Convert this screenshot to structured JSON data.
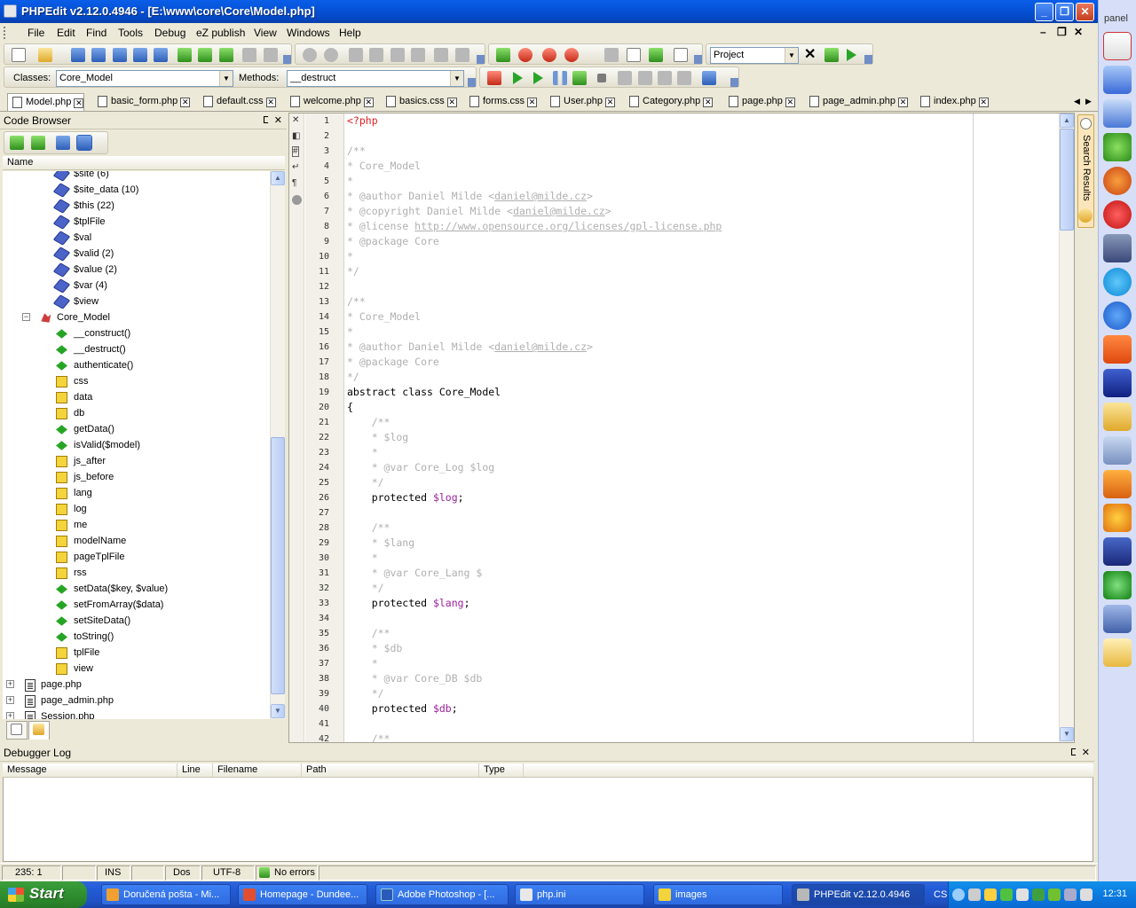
{
  "window": {
    "title": "PHPEdit v2.12.0.4946 - [E:\\www\\core\\Core\\Model.php]"
  },
  "menu": [
    "File",
    "Edit",
    "Find",
    "Tools",
    "Debug",
    "eZ publish",
    "View",
    "Windows",
    "Help"
  ],
  "toolbar": {
    "project_combo": "Project",
    "classes_label": "Classes:",
    "classes_value": "Core_Model",
    "methods_label": "Methods:",
    "methods_value": "__destruct"
  },
  "tabs": [
    "Model.php",
    "basic_form.php",
    "default.css",
    "welcome.php",
    "basics.css",
    "forms.css",
    "User.php",
    "Category.php",
    "page.php",
    "page_admin.php",
    "index.php"
  ],
  "code_browser": {
    "title": "Code Browser",
    "column_name": "Name",
    "items": [
      {
        "label": "$site  (6)",
        "icon": "var"
      },
      {
        "label": "$site_data   (10)",
        "icon": "var"
      },
      {
        "label": "$this   (22)",
        "icon": "var"
      },
      {
        "label": "$tplFile",
        "icon": "var"
      },
      {
        "label": "$val",
        "icon": "var"
      },
      {
        "label": "$valid   (2)",
        "icon": "var"
      },
      {
        "label": "$value   (2)",
        "icon": "var"
      },
      {
        "label": "$var   (4)",
        "icon": "var"
      },
      {
        "label": "$view",
        "icon": "var"
      },
      {
        "label": "Core_Model",
        "icon": "class"
      },
      {
        "label": "__construct()",
        "icon": "method"
      },
      {
        "label": "__destruct()",
        "icon": "method"
      },
      {
        "label": "authenticate()",
        "icon": "method"
      },
      {
        "label": "css",
        "icon": "property"
      },
      {
        "label": "data",
        "icon": "property"
      },
      {
        "label": "db",
        "icon": "property"
      },
      {
        "label": "getData()",
        "icon": "method"
      },
      {
        "label": "isValid($model)",
        "icon": "method"
      },
      {
        "label": "js_after",
        "icon": "property"
      },
      {
        "label": "js_before",
        "icon": "property"
      },
      {
        "label": "lang",
        "icon": "property"
      },
      {
        "label": "log",
        "icon": "property"
      },
      {
        "label": "me",
        "icon": "property"
      },
      {
        "label": "modelName",
        "icon": "property"
      },
      {
        "label": "pageTplFile",
        "icon": "property"
      },
      {
        "label": "rss",
        "icon": "property"
      },
      {
        "label": "setData($key, $value)",
        "icon": "method"
      },
      {
        "label": "setFromArray($data)",
        "icon": "method"
      },
      {
        "label": "setSiteData()",
        "icon": "method"
      },
      {
        "label": "toString()",
        "icon": "method"
      },
      {
        "label": "tplFile",
        "icon": "property"
      },
      {
        "label": "view",
        "icon": "property"
      },
      {
        "label": "page.php",
        "icon": "file"
      },
      {
        "label": "page_admin.php",
        "icon": "file"
      },
      {
        "label": "Session.php",
        "icon": "file"
      }
    ]
  },
  "editor": {
    "lines": [
      [
        {
          "t": "<?php",
          "c": "php"
        }
      ],
      [],
      [
        {
          "t": "/**",
          "c": "cmt"
        }
      ],
      [
        {
          "t": "* Core_Model",
          "c": "cmt"
        }
      ],
      [
        {
          "t": "*",
          "c": "cmt"
        }
      ],
      [
        {
          "t": "* @author Daniel Milde <",
          "c": "cmt"
        },
        {
          "t": "daniel@milde.cz",
          "c": "cmtu"
        },
        {
          "t": ">",
          "c": "cmt"
        }
      ],
      [
        {
          "t": "* @copyright Daniel Milde <",
          "c": "cmt"
        },
        {
          "t": "daniel@milde.cz",
          "c": "cmtu"
        },
        {
          "t": ">",
          "c": "cmt"
        }
      ],
      [
        {
          "t": "* @license ",
          "c": "cmt"
        },
        {
          "t": "http://www.opensource.org/licenses/gpl-license.php",
          "c": "cmtu"
        }
      ],
      [
        {
          "t": "* @package Core",
          "c": "cmt"
        }
      ],
      [
        {
          "t": "*",
          "c": "cmt"
        }
      ],
      [
        {
          "t": "*/",
          "c": "cmt"
        }
      ],
      [],
      [
        {
          "t": "/**",
          "c": "cmt"
        }
      ],
      [
        {
          "t": "* Core_Model",
          "c": "cmt"
        }
      ],
      [
        {
          "t": "*",
          "c": "cmt"
        }
      ],
      [
        {
          "t": "* @author Daniel Milde <",
          "c": "cmt"
        },
        {
          "t": "daniel@milde.cz",
          "c": "cmtu"
        },
        {
          "t": ">",
          "c": "cmt"
        }
      ],
      [
        {
          "t": "* @package Core",
          "c": "cmt"
        }
      ],
      [
        {
          "t": "*/",
          "c": "cmt"
        }
      ],
      [
        {
          "t": "abstract class Core_Model",
          "c": "kw"
        }
      ],
      [
        {
          "t": "{",
          "c": "kw"
        }
      ],
      [
        {
          "t": "    /**",
          "c": "cmt"
        }
      ],
      [
        {
          "t": "    * $log",
          "c": "cmt"
        }
      ],
      [
        {
          "t": "    *",
          "c": "cmt"
        }
      ],
      [
        {
          "t": "    * @var Core_Log $log",
          "c": "cmt"
        }
      ],
      [
        {
          "t": "    */",
          "c": "cmt"
        }
      ],
      [
        {
          "t": "    protected ",
          "c": "kw"
        },
        {
          "t": "$log",
          "c": "var2"
        },
        {
          "t": ";",
          "c": "kw"
        }
      ],
      [],
      [
        {
          "t": "    /**",
          "c": "cmt"
        }
      ],
      [
        {
          "t": "    * $lang",
          "c": "cmt"
        }
      ],
      [
        {
          "t": "    *",
          "c": "cmt"
        }
      ],
      [
        {
          "t": "    * @var Core_Lang $",
          "c": "cmt"
        }
      ],
      [
        {
          "t": "    */",
          "c": "cmt"
        }
      ],
      [
        {
          "t": "    protected ",
          "c": "kw"
        },
        {
          "t": "$lang",
          "c": "var2"
        },
        {
          "t": ";",
          "c": "kw"
        }
      ],
      [],
      [
        {
          "t": "    /**",
          "c": "cmt"
        }
      ],
      [
        {
          "t": "    * $db",
          "c": "cmt"
        }
      ],
      [
        {
          "t": "    *",
          "c": "cmt"
        }
      ],
      [
        {
          "t": "    * @var Core_DB $db",
          "c": "cmt"
        }
      ],
      [
        {
          "t": "    */",
          "c": "cmt"
        }
      ],
      [
        {
          "t": "    protected ",
          "c": "kw"
        },
        {
          "t": "$db",
          "c": "var2"
        },
        {
          "t": ";",
          "c": "kw"
        }
      ],
      [],
      [
        {
          "t": "    /**",
          "c": "cmt"
        }
      ]
    ]
  },
  "side_panel": {
    "search_results": "Search Results"
  },
  "debugger": {
    "title": "Debugger Log",
    "columns": [
      "Message",
      "Line",
      "Filename",
      "Path",
      "Type"
    ]
  },
  "status": {
    "position": "235:  1",
    "mode": "INS",
    "eol": "Dos",
    "encoding": "UTF-8",
    "errors": "No errors"
  },
  "right_bar": {
    "title": "panel"
  },
  "taskbar": {
    "start": "Start",
    "buttons": [
      {
        "label": "Doručená pošta - Mi...",
        "color": "#f0a030"
      },
      {
        "label": "Homepage - Dundee...",
        "color": "#e05030"
      },
      {
        "label": "Adobe Photoshop - [...",
        "color": "#2a5ab8"
      },
      {
        "label": "php.ini",
        "color": "#e8e8e8"
      },
      {
        "label": "images",
        "color": "#f3d43a"
      },
      {
        "label": "PHPEdit v2.12.0.4946",
        "color": "#b8b8b8"
      }
    ],
    "lang": "CS",
    "clock": "12:31"
  },
  "colors": {
    "titlebar": "#0653d8",
    "comment": "#b0b0b0",
    "variable": "#9b1f9b",
    "php_tag": "#e02020"
  }
}
